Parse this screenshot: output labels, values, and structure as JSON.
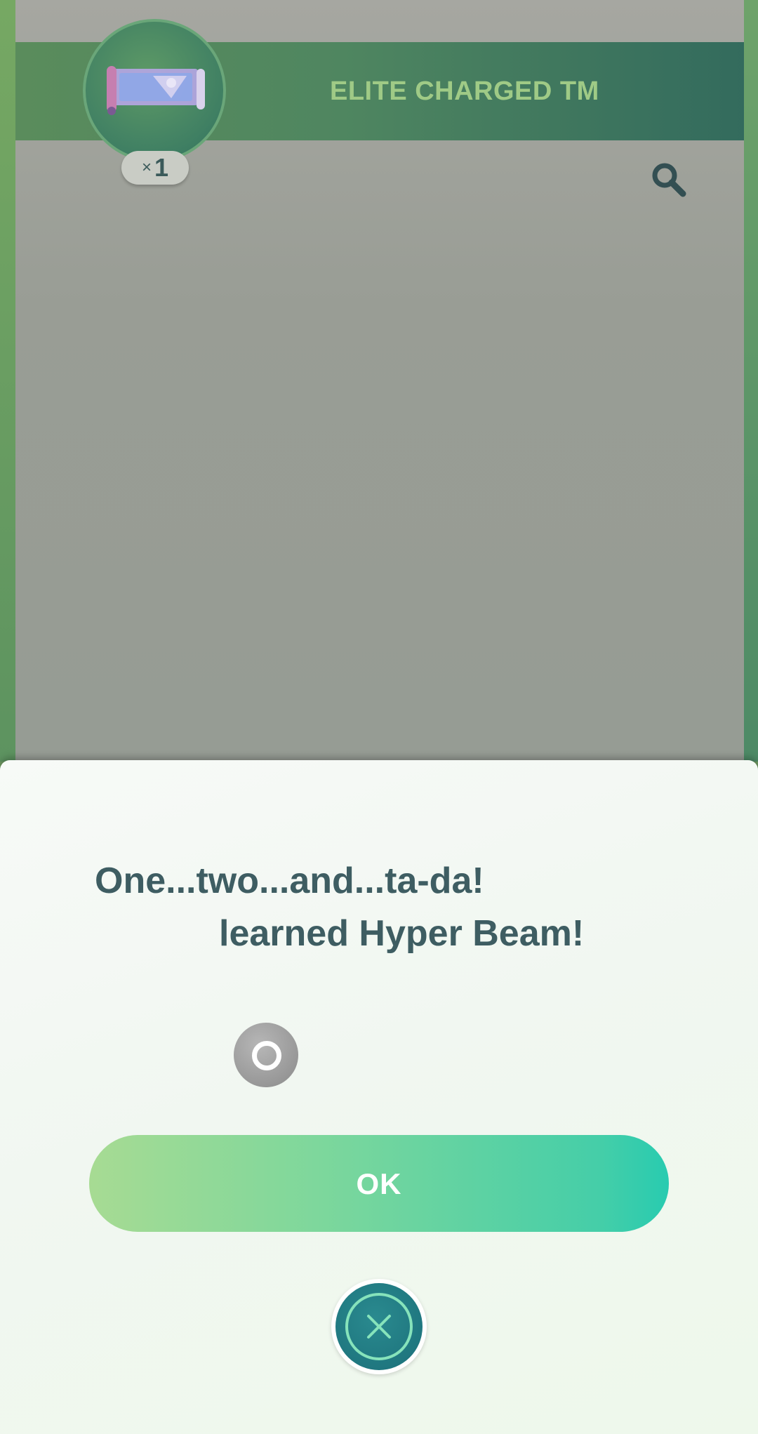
{
  "header": {
    "title": "ELITE CHARGED TM",
    "item_count_prefix": "×",
    "item_count": "1",
    "item_icon": "elite-charged-tm-scroll-icon",
    "search_icon": "search-icon"
  },
  "dialog": {
    "line1": "One...two...and...ta-da!",
    "line2": "learned Hyper Beam!",
    "move_type_icon": "normal-type-icon",
    "ok_label": "OK",
    "close_icon": "close-icon"
  },
  "colors": {
    "banner": "#4f8660",
    "banner_text": "#9fca86",
    "dialog_text": "#3e5d62",
    "ok_gradient_start": "#a7db93",
    "ok_gradient_end": "#28cbb0",
    "close_button": "#1b6f79"
  }
}
